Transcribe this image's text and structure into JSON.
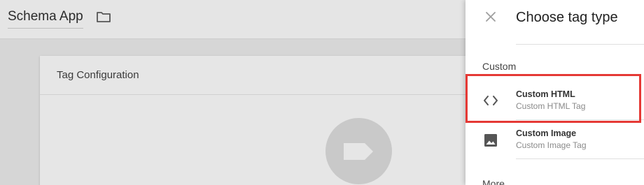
{
  "app": {
    "title": "Schema App",
    "folder_icon": "folder-icon"
  },
  "card": {
    "title": "Tag Configuration",
    "placeholder_icon": "tag-icon"
  },
  "panel": {
    "title": "Choose tag type",
    "close_icon": "close-icon",
    "sections": [
      {
        "label": "Custom",
        "items": [
          {
            "title": "Custom HTML",
            "subtitle": "Custom HTML Tag",
            "icon": "code-icon",
            "highlighted": true
          },
          {
            "title": "Custom Image",
            "subtitle": "Custom Image Tag",
            "icon": "image-icon",
            "highlighted": false
          }
        ]
      },
      {
        "label": "More"
      }
    ]
  },
  "colors": {
    "highlight": "#e53935",
    "overlay": "#d6d6d6",
    "panel_bg": "#ffffff"
  }
}
